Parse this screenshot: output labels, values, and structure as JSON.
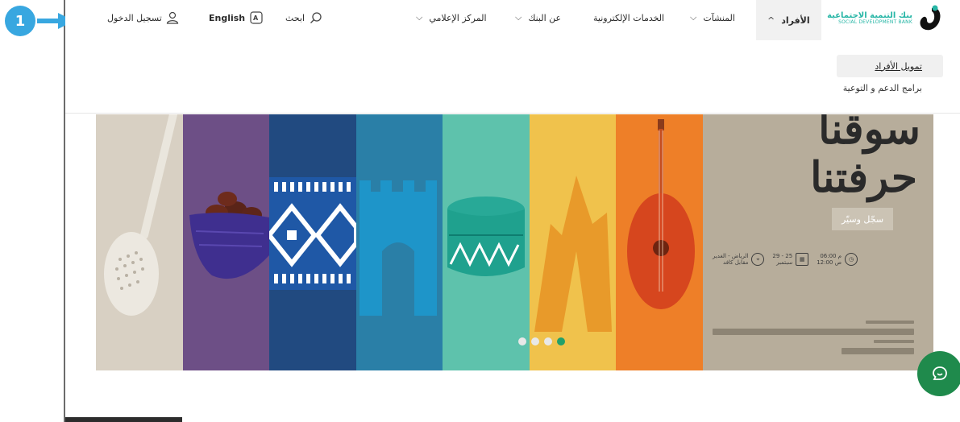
{
  "annotation": {
    "step_number": "1"
  },
  "header": {
    "login_label": "تسجيل الدخول",
    "language_label": "English",
    "search_label": "ابحث",
    "nav_items": [
      {
        "label": "المركز الإعلامي"
      },
      {
        "label": "عن البنك"
      },
      {
        "label": "الخدمات الإلكترونية"
      },
      {
        "label": "المنشآت"
      },
      {
        "label": "الأفراد"
      }
    ],
    "logo_arabic": "بنك التنمية الاجتماعية",
    "logo_english": "SOCIAL DEVELOPMENT BANK"
  },
  "submenu": {
    "items": [
      {
        "label": "تمويل الأفراد"
      },
      {
        "label": "برامج الدعم و التوعية"
      }
    ]
  },
  "hero": {
    "title_line_1": "سوقنا",
    "title_line_2": "حرفتنا",
    "cta_label": "سجّل وسيّر",
    "location": "الرياض - الغدير",
    "venue": "مقابل كافد",
    "dates": "29 - 25",
    "month": "سبتمبر",
    "time_1": "06:00 م",
    "time_2": "12:00 ص",
    "slides_total": 4,
    "active_slide": 4
  },
  "colors": {
    "accent_blue": "#38a7e0",
    "brand_green": "#23a06a",
    "chat_green": "#1f8a4c",
    "logo_teal": "#27b6a6"
  }
}
